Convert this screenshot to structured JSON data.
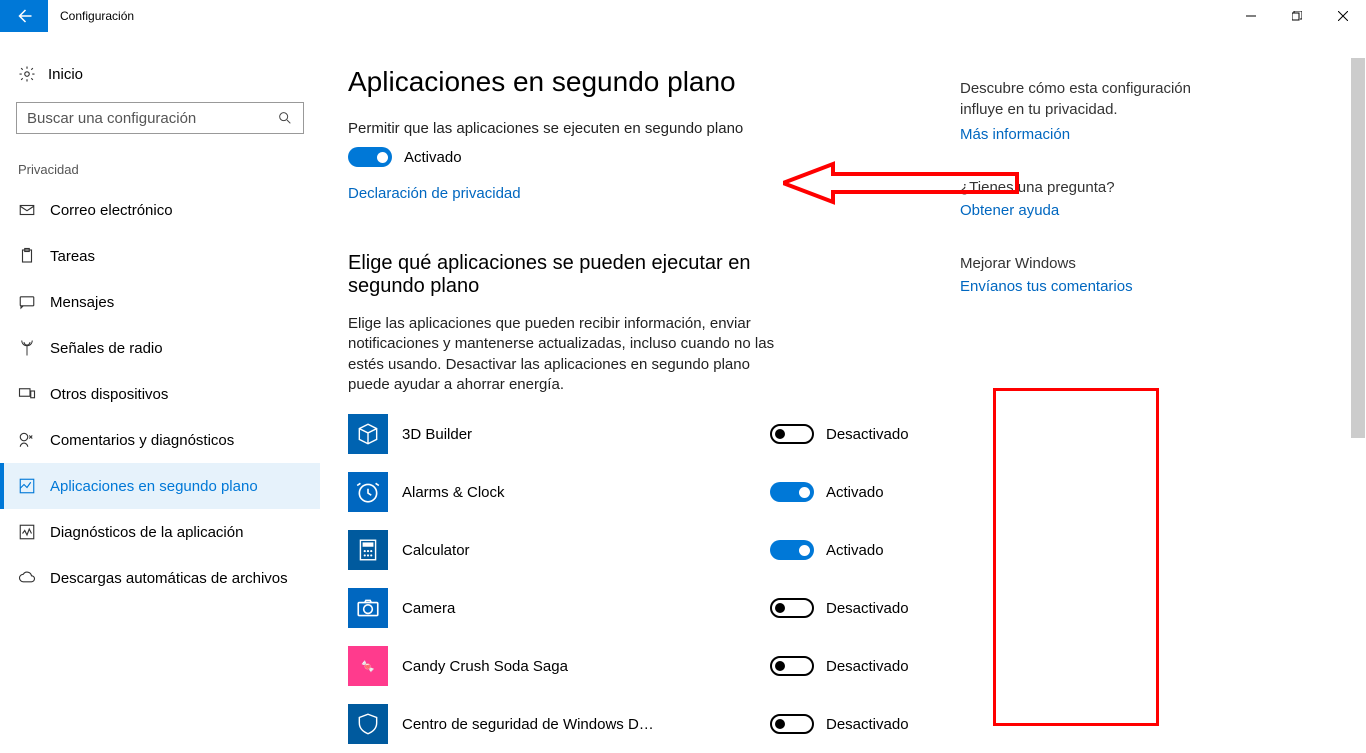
{
  "window": {
    "title": "Configuración"
  },
  "sidebar": {
    "home": "Inicio",
    "search_placeholder": "Buscar una configuración",
    "section": "Privacidad",
    "items": [
      {
        "label": "Correo electrónico"
      },
      {
        "label": "Tareas"
      },
      {
        "label": "Mensajes"
      },
      {
        "label": "Señales de radio"
      },
      {
        "label": "Otros dispositivos"
      },
      {
        "label": "Comentarios y diagnósticos"
      },
      {
        "label": "Aplicaciones en segundo plano"
      },
      {
        "label": "Diagnósticos de la aplicación"
      },
      {
        "label": "Descargas automáticas de archivos"
      }
    ]
  },
  "main": {
    "h1": "Aplicaciones en segundo plano",
    "allow_label": "Permitir que las aplicaciones se ejecuten en segundo plano",
    "master_state_label": "Activado",
    "privacy_link": "Declaración de privacidad",
    "h2": "Elige qué aplicaciones se pueden ejecutar en segundo plano",
    "desc": "Elige las aplicaciones que pueden recibir información, enviar notificaciones y mantenerse actualizadas, incluso cuando no las estés usando. Desactivar las aplicaciones en segundo plano puede ayudar a ahorrar energía.",
    "state_on": "Activado",
    "state_off": "Desactivado",
    "apps": [
      {
        "name": "3D Builder",
        "state": "off"
      },
      {
        "name": "Alarms & Clock",
        "state": "on"
      },
      {
        "name": "Calculator",
        "state": "on"
      },
      {
        "name": "Camera",
        "state": "off"
      },
      {
        "name": "Candy Crush Soda Saga",
        "state": "off"
      },
      {
        "name": "Centro de seguridad de Windows D…",
        "state": "off"
      }
    ]
  },
  "right": {
    "discover1": "Descubre cómo esta configuración influye en tu privacidad.",
    "discover_link": "Más información",
    "question_title": "¿Tienes una pregunta?",
    "question_link": "Obtener ayuda",
    "improve_title": "Mejorar Windows",
    "improve_link": "Envíanos tus comentarios"
  }
}
